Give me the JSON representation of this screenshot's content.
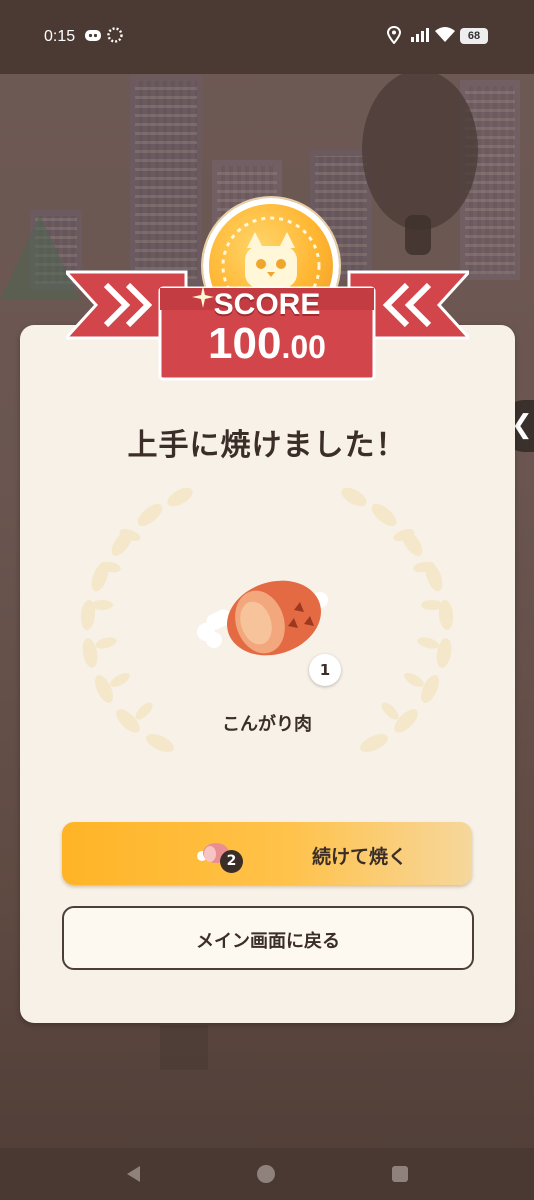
{
  "status_bar": {
    "time": "0:15",
    "battery_level": "68",
    "icons": [
      "discord-icon",
      "loading-icon",
      "location-icon",
      "signal-icon",
      "wifi-icon",
      "battery-icon"
    ]
  },
  "result": {
    "score_label": "SCORE",
    "score_integer": "100",
    "score_decimal": ".00",
    "headline": "上手に焼けました！",
    "item": {
      "name": "こんがり肉",
      "count": "1",
      "icon": "roasted-meat-icon"
    }
  },
  "buttons": {
    "continue": {
      "label": "続けて焼く",
      "cost": "2",
      "icon": "raw-meat-icon"
    },
    "return": {
      "label": "メイン画面に戻る"
    }
  },
  "side_panel": {
    "icon": "chevron-left-icon"
  },
  "nav_bar": {
    "icons": [
      "back-icon",
      "home-icon",
      "recents-icon"
    ]
  },
  "colors": {
    "ribbon_red": "#d2454a",
    "card_bg": "#f7f1e8",
    "primary_button": "#ffb426",
    "text_dark": "#3b2e29",
    "coin_gold": "#ffb530"
  }
}
